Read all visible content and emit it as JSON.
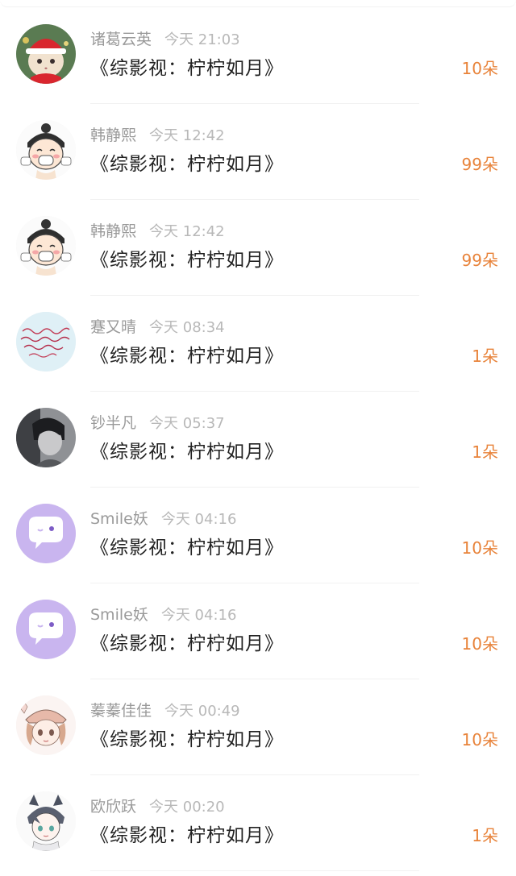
{
  "records": [
    {
      "name": "诸葛云英",
      "time": "今天 21:03",
      "title": "《综影视：柠柠如月》",
      "amount": "10朵",
      "avatar": "cat-santa-hat"
    },
    {
      "name": "韩静熙",
      "time": "今天 12:42",
      "title": "《综影视：柠柠如月》",
      "amount": "99朵",
      "avatar": "cartoon-girl-mask"
    },
    {
      "name": "韩静熙",
      "time": "今天 12:42",
      "title": "《综影视：柠柠如月》",
      "amount": "99朵",
      "avatar": "cartoon-girl-mask"
    },
    {
      "name": "蹇又晴",
      "time": "今天 08:34",
      "title": "《综影视：柠柠如月》",
      "amount": "1朵",
      "avatar": "handwriting-blue"
    },
    {
      "name": "钞半凡",
      "time": "今天 05:37",
      "title": "《综影视：柠柠如月》",
      "amount": "1朵",
      "avatar": "man-gray-photo"
    },
    {
      "name": "Smile妖",
      "time": "今天 04:16",
      "title": "《综影视：柠柠如月》",
      "amount": "10朵",
      "avatar": "purple-chat-bubble"
    },
    {
      "name": "Smile妖",
      "time": "今天 04:16",
      "title": "《综影视：柠柠如月》",
      "amount": "10朵",
      "avatar": "purple-chat-bubble"
    },
    {
      "name": "蓁蓁佳佳",
      "time": "今天 00:49",
      "title": "《综影视：柠柠如月》",
      "amount": "10朵",
      "avatar": "anime-girl-hat"
    },
    {
      "name": "欧欣跃",
      "time": "今天 00:20",
      "title": "《综影视：柠柠如月》",
      "amount": "1朵",
      "avatar": "anime-boy-cat-ears"
    }
  ],
  "colors": {
    "amount": "#e8833a",
    "name": "#9a9a9a",
    "time": "#b8b8b8",
    "title": "#222222",
    "purple_avatar": "#c9b5ef"
  }
}
